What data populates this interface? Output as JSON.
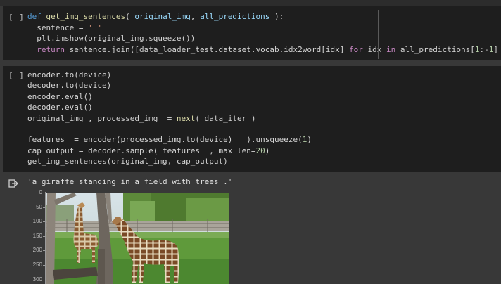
{
  "cell1": {
    "run_button": "[ ]",
    "lines": [
      [
        {
          "t": "def ",
          "c": "def"
        },
        {
          "t": "get_img_sentences",
          "c": "fn"
        },
        {
          "t": "( ",
          "c": ""
        },
        {
          "t": "original_img",
          "c": "pm"
        },
        {
          "t": ", ",
          "c": ""
        },
        {
          "t": "all_predictions",
          "c": "pm"
        },
        {
          "t": " ):",
          "c": ""
        }
      ],
      [
        {
          "t": "  sentence = ",
          "c": ""
        },
        {
          "t": "' '",
          "c": "st"
        }
      ],
      [
        {
          "t": "  plt.imshow(original_img.squeeze())",
          "c": ""
        }
      ],
      [
        {
          "t": "  ",
          "c": ""
        },
        {
          "t": "return",
          "c": "kw"
        },
        {
          "t": " sentence.join([data_loader_test.dataset.vocab.idx2word[idx] ",
          "c": ""
        },
        {
          "t": "for",
          "c": "kw"
        },
        {
          "t": " idx ",
          "c": ""
        },
        {
          "t": "in",
          "c": "kw"
        },
        {
          "t": " all_predictions[",
          "c": ""
        },
        {
          "t": "1",
          "c": "nu"
        },
        {
          "t": ":-",
          "c": ""
        },
        {
          "t": "1",
          "c": "nu"
        },
        {
          "t": "] ]  )",
          "c": ""
        }
      ]
    ]
  },
  "cell2": {
    "run_button": "[ ]",
    "lines": [
      [
        {
          "t": "encoder.to(device)",
          "c": ""
        }
      ],
      [
        {
          "t": "decoder.to(device)",
          "c": ""
        }
      ],
      [
        {
          "t": "encoder.eval()",
          "c": ""
        }
      ],
      [
        {
          "t": "decoder.eval()",
          "c": ""
        }
      ],
      [
        {
          "t": "original_img , processed_img  = ",
          "c": ""
        },
        {
          "t": "next",
          "c": "fn"
        },
        {
          "t": "( data_iter )",
          "c": ""
        }
      ],
      [
        {
          "t": "",
          "c": ""
        }
      ],
      [
        {
          "t": "features  = encoder(processed_img.to(device)   ).unsqueeze(",
          "c": ""
        },
        {
          "t": "1",
          "c": "nu"
        },
        {
          "t": ")",
          "c": ""
        }
      ],
      [
        {
          "t": "cap_output = decoder.sample( features  , max_len=",
          "c": ""
        },
        {
          "t": "20",
          "c": "nu"
        },
        {
          "t": ")",
          "c": ""
        }
      ],
      [
        {
          "t": "get_img_sentences(original_img, cap_output)",
          "c": ""
        }
      ]
    ]
  },
  "output": {
    "text": "'a giraffe standing in a field with trees .'",
    "yticks": [
      "0",
      "50",
      "100",
      "150",
      "200",
      "250",
      "300"
    ]
  },
  "colors": {
    "cell_bg": "#1e1e1e",
    "page_bg": "#383838"
  }
}
